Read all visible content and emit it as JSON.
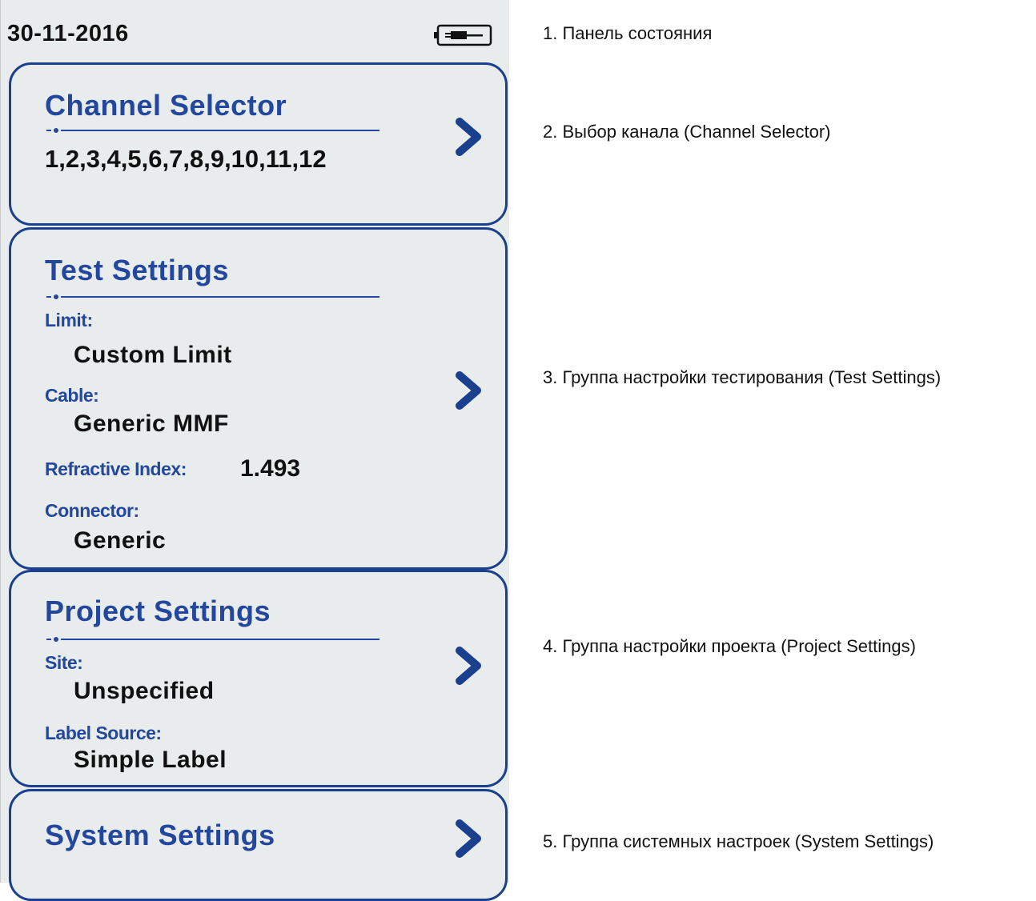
{
  "status_bar": {
    "date": "30-11-2016",
    "icon": "battery-plug-icon"
  },
  "channel_selector": {
    "title": "Channel Selector",
    "channels": "1,2,3,4,5,6,7,8,9,10,11,12"
  },
  "test_settings": {
    "title": "Test Settings",
    "limit_label": "Limit:",
    "limit_value": "Custom Limit",
    "cable_label": "Cable:",
    "cable_value": "Generic MMF",
    "refractive_label": "Refractive Index:",
    "refractive_value": "1.493",
    "connector_label": "Connector:",
    "connector_value": "Generic"
  },
  "project_settings": {
    "title": "Project Settings",
    "site_label": "Site:",
    "site_value": "Unspecified",
    "label_source_label": "Label Source:",
    "label_source_value": "Simple Label"
  },
  "system_settings": {
    "title": "System Settings"
  },
  "annotations": [
    "1. Панель состояния",
    "2. Выбор канала (Channel Selector)",
    "3. Группа настройки тестирования (Test Settings)",
    "4. Группа настройки проекта (Project Settings)",
    "5. Группа системных настроек (System Settings)"
  ],
  "colors": {
    "accent": "#24479e",
    "border": "#1a3f8c",
    "panel_bg": "#e9ecec"
  }
}
